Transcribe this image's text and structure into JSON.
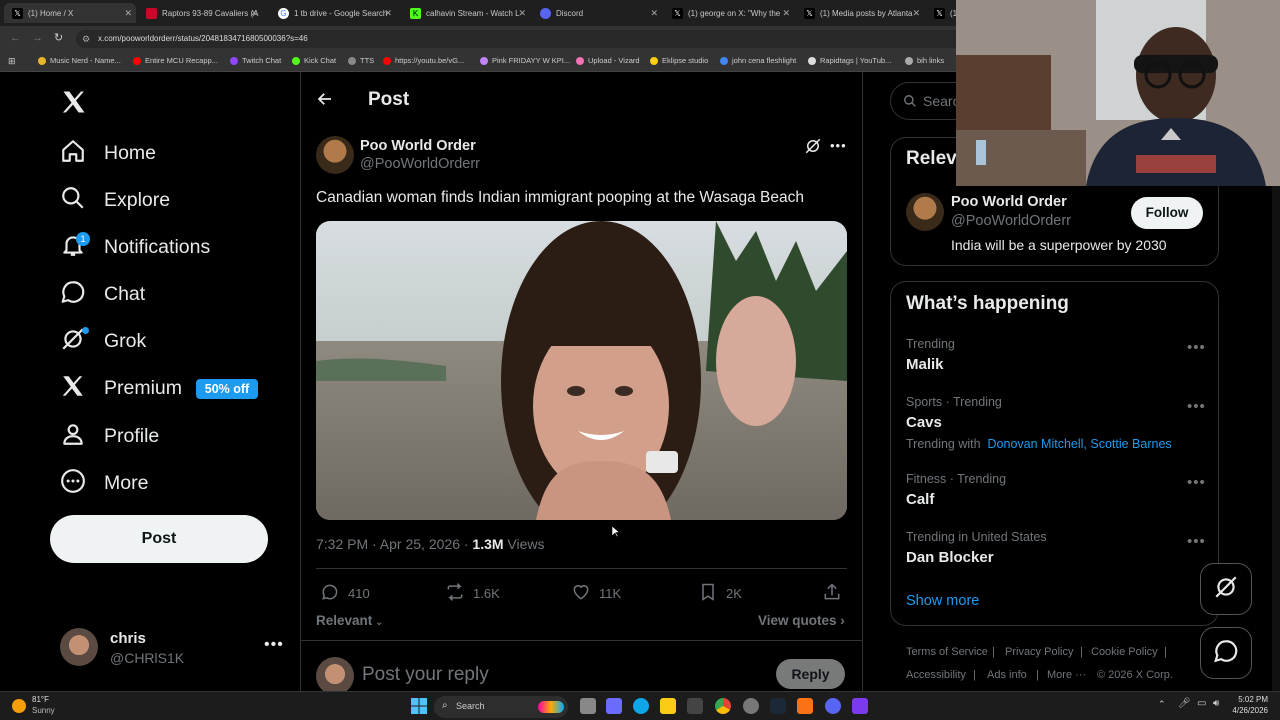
{
  "browser": {
    "tabs": [
      {
        "label": "(1) Home / X",
        "favicon": "x-logo"
      },
      {
        "label": "Raptors 93-89 Cavaliers (A",
        "favicon": "nba"
      },
      {
        "label": "1 tb drive - Google Search",
        "favicon": "google"
      },
      {
        "label": "calhavin Stream - Watch L",
        "favicon": "kick"
      },
      {
        "label": "Discord",
        "favicon": "discord"
      },
      {
        "label": "(1) george on X: \"Why the",
        "favicon": "x-logo"
      },
      {
        "label": "(1) Media posts by Atlanta",
        "favicon": "x-logo"
      },
      {
        "label": "(1",
        "favicon": "x-logo"
      }
    ],
    "url": "x.com/pooworldorderr/status/2048183471680500036?s=46",
    "bookmarks": [
      "Music Nerd - Name...",
      "Entire MCU Recapp...",
      "Twitch Chat",
      "Kick Chat",
      "TTS",
      "https://youtu.be/vG...",
      "Pink FRIDAYY W KPI...",
      "Upload - Vizard",
      "Eklipse studio",
      "john cena fleshlight",
      "Rapidtags | YouTub...",
      "bih links"
    ]
  },
  "sidebar": {
    "items": [
      {
        "label": "Home",
        "icon": "home-icon"
      },
      {
        "label": "Explore",
        "icon": "search-icon"
      },
      {
        "label": "Notifications",
        "icon": "bell-icon",
        "badge": "1"
      },
      {
        "label": "Chat",
        "icon": "chat-icon"
      },
      {
        "label": "Grok",
        "icon": "grok-icon"
      },
      {
        "label": "Premium",
        "icon": "x-logo-icon",
        "promo": "50% off"
      },
      {
        "label": "Profile",
        "icon": "person-icon"
      },
      {
        "label": "More",
        "icon": "more-circle-icon"
      }
    ],
    "post_button": "Post",
    "account": {
      "name": "chris",
      "handle": "@CHRlS1K"
    }
  },
  "post": {
    "header_title": "Post",
    "author_name": "Poo World Order",
    "author_handle": "@PooWorldOrderr",
    "text": "Canadian woman finds Indian immigrant pooping at the Wasaga Beach",
    "time": "7:32 PM · Apr 25, 2026 · ",
    "views_count": "1.3M",
    "views_label": " Views",
    "replies": "410",
    "reposts": "1.6K",
    "likes": "11K",
    "bookmarks": "2K",
    "sort_label": "Relevant",
    "view_quotes": "View quotes",
    "reply_placeholder": "Post your reply",
    "reply_button": "Reply"
  },
  "right": {
    "search_placeholder": "Searc",
    "relevant_heading": "Relev",
    "relevant_person": {
      "name": "Poo World Order",
      "handle": "@PooWorldOrderr",
      "bio": "India will be a superpower by 2030",
      "follow": "Follow"
    },
    "happening_heading": "What’s happening",
    "trends": [
      {
        "context": "Trending",
        "name": "Malik"
      },
      {
        "context": "Sports · Trending",
        "name": "Cavs",
        "with_label": "Trending with",
        "with_names": "Donovan Mitchell, Scottie Barnes"
      },
      {
        "context": "Fitness · Trending",
        "name": "Calf"
      },
      {
        "context": "Trending in United States",
        "name": "Dan Blocker"
      }
    ],
    "show_more": "Show more",
    "footer": {
      "terms": "Terms of Service",
      "privacy": "Privacy Policy",
      "cookie": "Cookie Policy",
      "accessibility": "Accessibility",
      "ads": "Ads info",
      "more": "More ···",
      "copyright": "© 2026 X Corp."
    }
  },
  "taskbar": {
    "weather_temp": "81°F",
    "weather_desc": "Sunny",
    "search_label": "Search",
    "time": "5:02 PM",
    "date": "4/26/2026"
  },
  "colors": {
    "accent": "#1d9bf0",
    "background": "#000000",
    "border": "#2f3336",
    "muted": "#71767b"
  }
}
